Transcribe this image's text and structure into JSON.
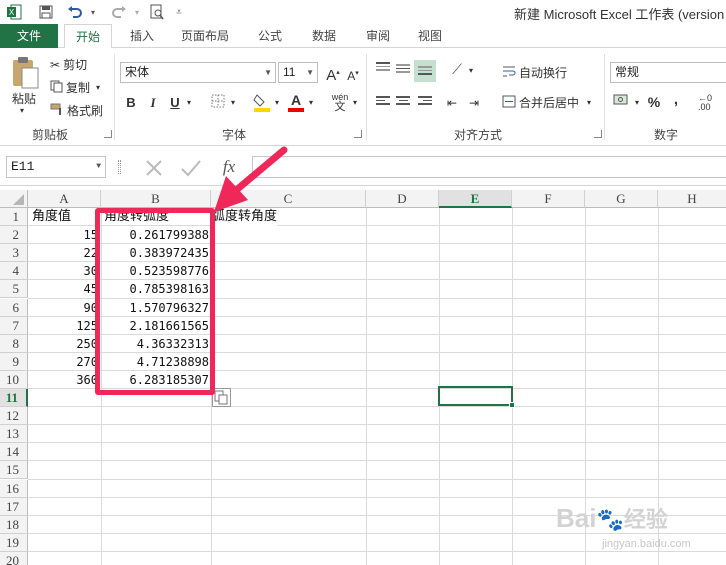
{
  "title_bar": {
    "title": "新建 Microsoft Excel 工作表 (version"
  },
  "tabs": [
    "文件",
    "开始",
    "插入",
    "页面布局",
    "公式",
    "数据",
    "审阅",
    "视图"
  ],
  "clipboard": {
    "paste": "粘贴",
    "cut": "剪切",
    "copy": "复制",
    "format_painter": "格式刷",
    "group": "剪贴板"
  },
  "font": {
    "name": "宋体",
    "size": "11",
    "grow": "A",
    "shrink": "A",
    "bold": "B",
    "italic": "I",
    "underline": "U",
    "font_color": "A",
    "phonetic": "wén",
    "group": "字体"
  },
  "alignment": {
    "wrap_text": "自动换行",
    "merge_center": "合并后居中",
    "group": "对齐方式"
  },
  "number": {
    "format": "常规",
    "percent": "%",
    "comma": ",",
    "group": "数字"
  },
  "formula_bar": {
    "name_box": "E11",
    "fx": "fx",
    "value": ""
  },
  "columns": [
    "A",
    "B",
    "C",
    "D",
    "E",
    "F",
    "G",
    "H"
  ],
  "rows": [
    "1",
    "2",
    "3",
    "4",
    "5",
    "6",
    "7",
    "8",
    "9",
    "10",
    "11",
    "12",
    "13",
    "14",
    "15",
    "16",
    "17",
    "18",
    "19",
    "20"
  ],
  "cells": {
    "headers": [
      "角度值",
      "角度转弧度",
      "弧度转角度"
    ],
    "col_a": [
      "15",
      "22",
      "30",
      "45",
      "90",
      "125",
      "250",
      "270",
      "360"
    ],
    "col_b": [
      "0.261799388",
      "0.383972435",
      "0.523598776",
      "0.785398163",
      "1.570796327",
      "2.181661565",
      "4.36332313",
      "4.71238898",
      "6.283185307"
    ]
  },
  "watermark": {
    "brand": "Bai",
    "brand_cn": "经验",
    "url": "jingyan.baidu.com"
  },
  "colors": {
    "accent": "#217346",
    "highlight": "#f0285a",
    "selection": "#217346"
  }
}
